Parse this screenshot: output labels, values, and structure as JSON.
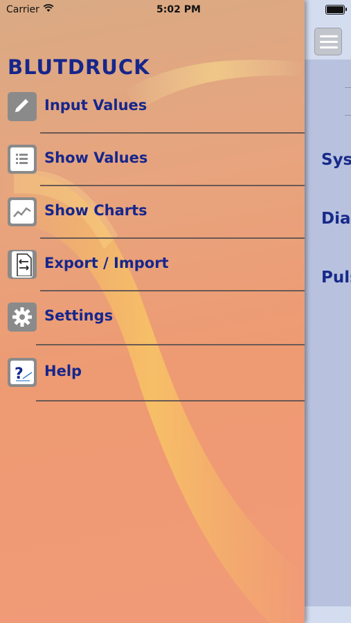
{
  "status_bar": {
    "carrier": "Carrier",
    "time": "5:02 PM"
  },
  "drawer": {
    "title": "BLUTDRUCK",
    "items": [
      {
        "label": "Input Values",
        "icon": "pencil-icon"
      },
      {
        "label": "Show Values",
        "icon": "list-icon"
      },
      {
        "label": "Show Charts",
        "icon": "chart-icon"
      },
      {
        "label": "Export / Import",
        "icon": "export-import-icon"
      },
      {
        "label": "Settings",
        "icon": "gear-icon"
      },
      {
        "label": "Help",
        "icon": "help-icon"
      }
    ]
  },
  "main": {
    "labels": [
      "Sys",
      "Dia",
      "Puls"
    ]
  }
}
